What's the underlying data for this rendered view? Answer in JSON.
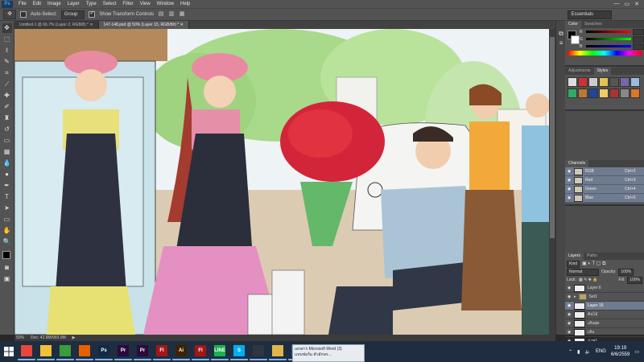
{
  "app": {
    "logo": "Ps"
  },
  "menu": [
    "File",
    "Edit",
    "Image",
    "Layer",
    "Type",
    "Select",
    "Filter",
    "View",
    "Window",
    "Help"
  ],
  "window_controls": [
    "—",
    "▭",
    "✕"
  ],
  "options_bar": {
    "auto_select_label": "Auto-Select:",
    "auto_select_target": "Group",
    "show_transform_label": "Show Transform Controls",
    "workspace": "Essentials"
  },
  "doc_tabs": [
    {
      "label": "Untitled-1 @ 66.7% (Layer 2, RGB/8) *  ✕",
      "active": false
    },
    {
      "label": "147-148.psd @ 50% (Layer 15, RGB/8#) *  ✕",
      "active": true
    }
  ],
  "status": {
    "zoom": "50%",
    "doc": "Doc: 42.9M/993.0M"
  },
  "panels": {
    "color": {
      "tabs": [
        "Color",
        "Swatches"
      ],
      "channels": [
        "R",
        "G",
        "B"
      ]
    },
    "adjustments": {
      "tabs": [
        "Adjustments",
        "Styles"
      ]
    },
    "channels": {
      "tab": "Channels",
      "rows": [
        {
          "name": "RGB",
          "shortcut": "Ctrl+2"
        },
        {
          "name": "Red",
          "shortcut": "Ctrl+3"
        },
        {
          "name": "Green",
          "shortcut": "Ctrl+4"
        },
        {
          "name": "Blue",
          "shortcut": "Ctrl+5"
        }
      ]
    },
    "layers": {
      "tabs": [
        "Layers",
        "Paths"
      ],
      "kind": "Kind",
      "blend_mode": "Normal",
      "opacity_label": "Opacity:",
      "opacity": "100%",
      "lock_label": "Lock:",
      "fill_label": "Fill:",
      "fill": "100%",
      "rows": [
        {
          "name": "Layer 6",
          "type": "layer",
          "selected": false
        },
        {
          "name": "Set1",
          "type": "folder",
          "selected": false
        },
        {
          "name": "Layer 15",
          "type": "layer",
          "selected": true
        },
        {
          "name": "ต้นไม้",
          "type": "layer",
          "selected": false
        },
        {
          "name": "เส้นสุด",
          "type": "layer",
          "selected": false
        },
        {
          "name": "เส้น",
          "type": "layer",
          "selected": false
        },
        {
          "name": "ภาพ1",
          "type": "layer",
          "selected": false
        }
      ]
    }
  },
  "taskbar": {
    "apps": [
      {
        "name": "chrome",
        "label": "",
        "color": "#e8453c",
        "running": true
      },
      {
        "name": "explorer",
        "label": "",
        "color": "#f2c037",
        "running": true
      },
      {
        "name": "store",
        "label": "",
        "color": "#3a9c3a",
        "running": true
      },
      {
        "name": "firefox",
        "label": "",
        "color": "#e66000",
        "running": true
      },
      {
        "name": "photoshop",
        "label": "Ps",
        "color": "#0e2a47",
        "running": true
      },
      {
        "name": "premiere",
        "label": "Pr",
        "color": "#2a0b3e",
        "running": true
      },
      {
        "name": "premiere-2",
        "label": "Pr",
        "color": "#2a0b3e",
        "running": true
      },
      {
        "name": "flash",
        "label": "Fl",
        "color": "#a41616",
        "running": true
      },
      {
        "name": "illustrator",
        "label": "Ai",
        "color": "#3d2300",
        "running": true
      },
      {
        "name": "flash-2",
        "label": "Fl",
        "color": "#a41616",
        "running": true
      },
      {
        "name": "line",
        "label": "LINE",
        "color": "#19b34a",
        "running": true
      },
      {
        "name": "skype",
        "label": "S",
        "color": "#00aff0",
        "running": true
      },
      {
        "name": "media",
        "label": "",
        "color": "#2f3640",
        "running": true
      },
      {
        "name": "folder",
        "label": "",
        "color": "#e0b64c",
        "running": true
      },
      {
        "name": "word",
        "label": "W",
        "color": "#2b579a",
        "running": true
      }
    ],
    "popup_line1": "เอกสาร Microsoft Word (3)",
    "popup_line2": "แบบฟอร์ม ตัวอักษร...",
    "language": "ENG",
    "time": "19:19",
    "date": "6/6/2559"
  }
}
